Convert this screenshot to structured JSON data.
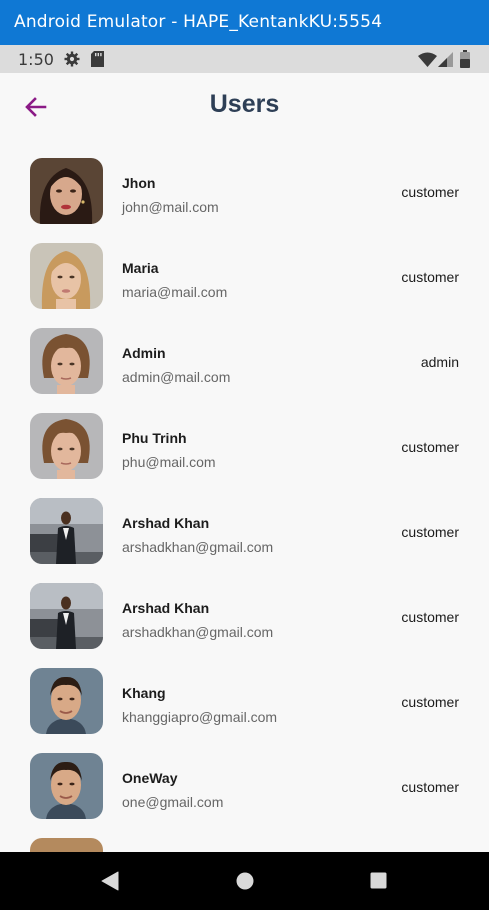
{
  "window": {
    "title": "Android Emulator - HAPE_KentankKU:5554"
  },
  "status_bar": {
    "time": "1:50",
    "left_icons": [
      "settings-gear-icon",
      "sd-card-icon"
    ],
    "right_icons": [
      "wifi-icon",
      "cell-signal-icon",
      "battery-icon"
    ]
  },
  "appbar": {
    "title": "Users",
    "back_icon": "arrow-back-icon",
    "accent": "#8b1a86"
  },
  "users": [
    {
      "name": "Jhon",
      "email": "john@mail.com",
      "role": "customer",
      "avatar": "woman-dark-hair"
    },
    {
      "name": "Maria",
      "email": "maria@mail.com",
      "role": "customer",
      "avatar": "woman-light-hair"
    },
    {
      "name": "Admin",
      "email": "admin@mail.com",
      "role": "admin",
      "avatar": "man-curly-hair"
    },
    {
      "name": "Phu Trinh",
      "email": "phu@mail.com",
      "role": "customer",
      "avatar": "man-curly-hair"
    },
    {
      "name": "Arshad Khan",
      "email": "arshadkhan@gmail.com",
      "role": "customer",
      "avatar": "man-in-suit"
    },
    {
      "name": "Arshad Khan",
      "email": "arshadkhan@gmail.com",
      "role": "customer",
      "avatar": "man-in-suit"
    },
    {
      "name": "Khang",
      "email": "khanggiapro@gmail.com",
      "role": "customer",
      "avatar": "man-portrait"
    },
    {
      "name": "OneWay",
      "email": "one@gmail.com",
      "role": "customer",
      "avatar": "man-portrait"
    }
  ],
  "nav_bar": {
    "buttons": [
      "back-triangle-icon",
      "home-circle-icon",
      "recents-square-icon"
    ]
  }
}
